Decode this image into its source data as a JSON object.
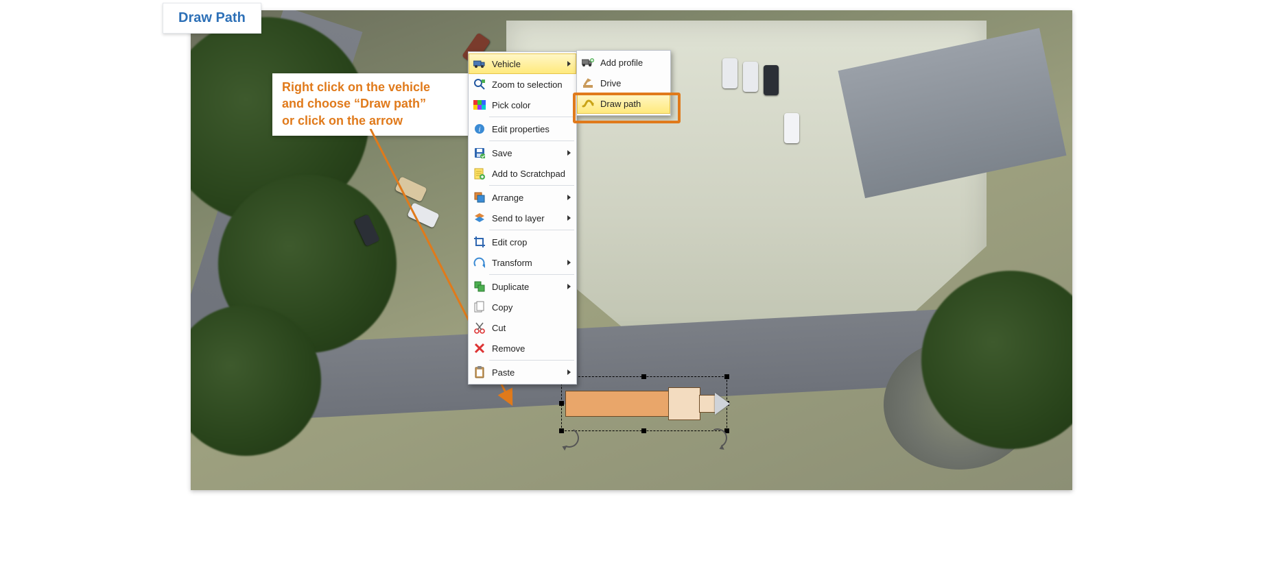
{
  "title": "Draw Path",
  "instruction": {
    "line1": "Right click on the vehicle",
    "line2": "and choose “Draw path”",
    "line3": "or click on the arrow"
  },
  "context_menu": {
    "items": [
      {
        "label": "Vehicle",
        "icon": "vehicle-icon",
        "submenu": true,
        "highlighted": true
      },
      {
        "label": "Zoom to selection",
        "icon": "zoom-icon",
        "submenu": false
      },
      {
        "label": "Pick color",
        "icon": "palette-icon",
        "submenu": false
      },
      {
        "sep": true
      },
      {
        "label": "Edit properties",
        "icon": "properties-icon",
        "submenu": false
      },
      {
        "sep": true
      },
      {
        "label": "Save",
        "icon": "save-icon",
        "submenu": true
      },
      {
        "label": "Add to Scratchpad",
        "icon": "scratchpad-icon",
        "submenu": false
      },
      {
        "sep": true
      },
      {
        "label": "Arrange",
        "icon": "arrange-icon",
        "submenu": true
      },
      {
        "label": "Send to layer",
        "icon": "layers-icon",
        "submenu": true
      },
      {
        "sep": true
      },
      {
        "label": "Edit crop",
        "icon": "crop-icon",
        "submenu": false
      },
      {
        "label": "Transform",
        "icon": "transform-icon",
        "submenu": true
      },
      {
        "sep": true
      },
      {
        "label": "Duplicate",
        "icon": "duplicate-icon",
        "submenu": true
      },
      {
        "label": "Copy",
        "icon": "copy-icon",
        "submenu": false
      },
      {
        "label": "Cut",
        "icon": "cut-icon",
        "submenu": false
      },
      {
        "label": "Remove",
        "icon": "remove-icon",
        "submenu": false
      },
      {
        "sep": true
      },
      {
        "label": "Paste",
        "icon": "paste-icon",
        "submenu": true
      }
    ]
  },
  "vehicle_submenu": {
    "items": [
      {
        "label": "Add profile",
        "icon": "add-profile-icon"
      },
      {
        "label": "Drive",
        "icon": "drive-icon"
      },
      {
        "label": "Draw path",
        "icon": "draw-path-icon",
        "highlighted": true
      }
    ]
  },
  "colors": {
    "accent_orange": "#e07a1b",
    "title_blue": "#2d70b7",
    "menu_hover": "#ffe97a"
  }
}
